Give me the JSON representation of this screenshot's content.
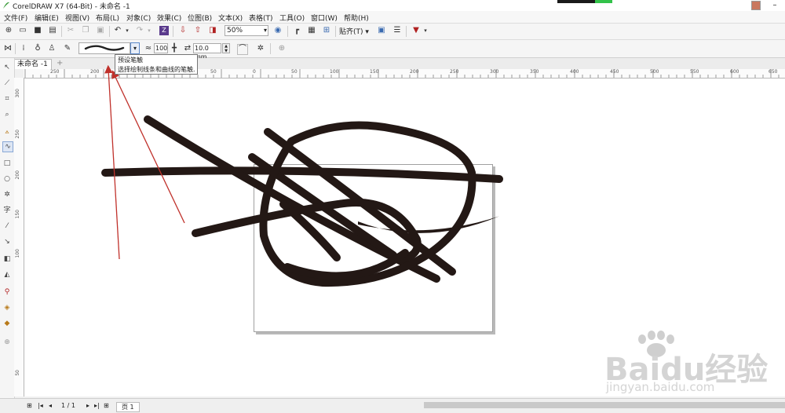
{
  "window": {
    "title": "CorelDRAW X7 (64-Bit) - 未命名 -1"
  },
  "menu": [
    "文件(F)",
    "编辑(E)",
    "视图(V)",
    "布局(L)",
    "对象(C)",
    "效果(C)",
    "位图(B)",
    "文本(X)",
    "表格(T)",
    "工具(O)",
    "窗口(W)",
    "帮助(H)"
  ],
  "toolbar": {
    "zoom_value": "50%",
    "snap_label": "贴齐(T)"
  },
  "property_bar": {
    "smoothing_value": "100",
    "stroke_size_value": "10.0 mm"
  },
  "tooltip": {
    "title": "预设笔触",
    "description": "选择绘制线条和曲线的笔触."
  },
  "document_tab": {
    "label": "未命名 -1"
  },
  "ruler": {
    "h_labels": [
      "250",
      "200",
      "150",
      "100",
      "50",
      "0",
      "50",
      "100",
      "150",
      "200",
      "250",
      "300",
      "350",
      "400",
      "450",
      "500",
      "550",
      "600",
      "650"
    ],
    "v_labels": [
      "300",
      "250",
      "200",
      "150",
      "100",
      "50"
    ]
  },
  "statusbar": {
    "page_count": "1 / 1",
    "page_tab": "页 1"
  },
  "watermark": {
    "line1": "Baidu经验",
    "line2": "jingyan.baidu.com"
  },
  "colors": {
    "stroke": "#231815",
    "annotation_arrow": "#c0312b",
    "accent": "#5a87c8"
  }
}
